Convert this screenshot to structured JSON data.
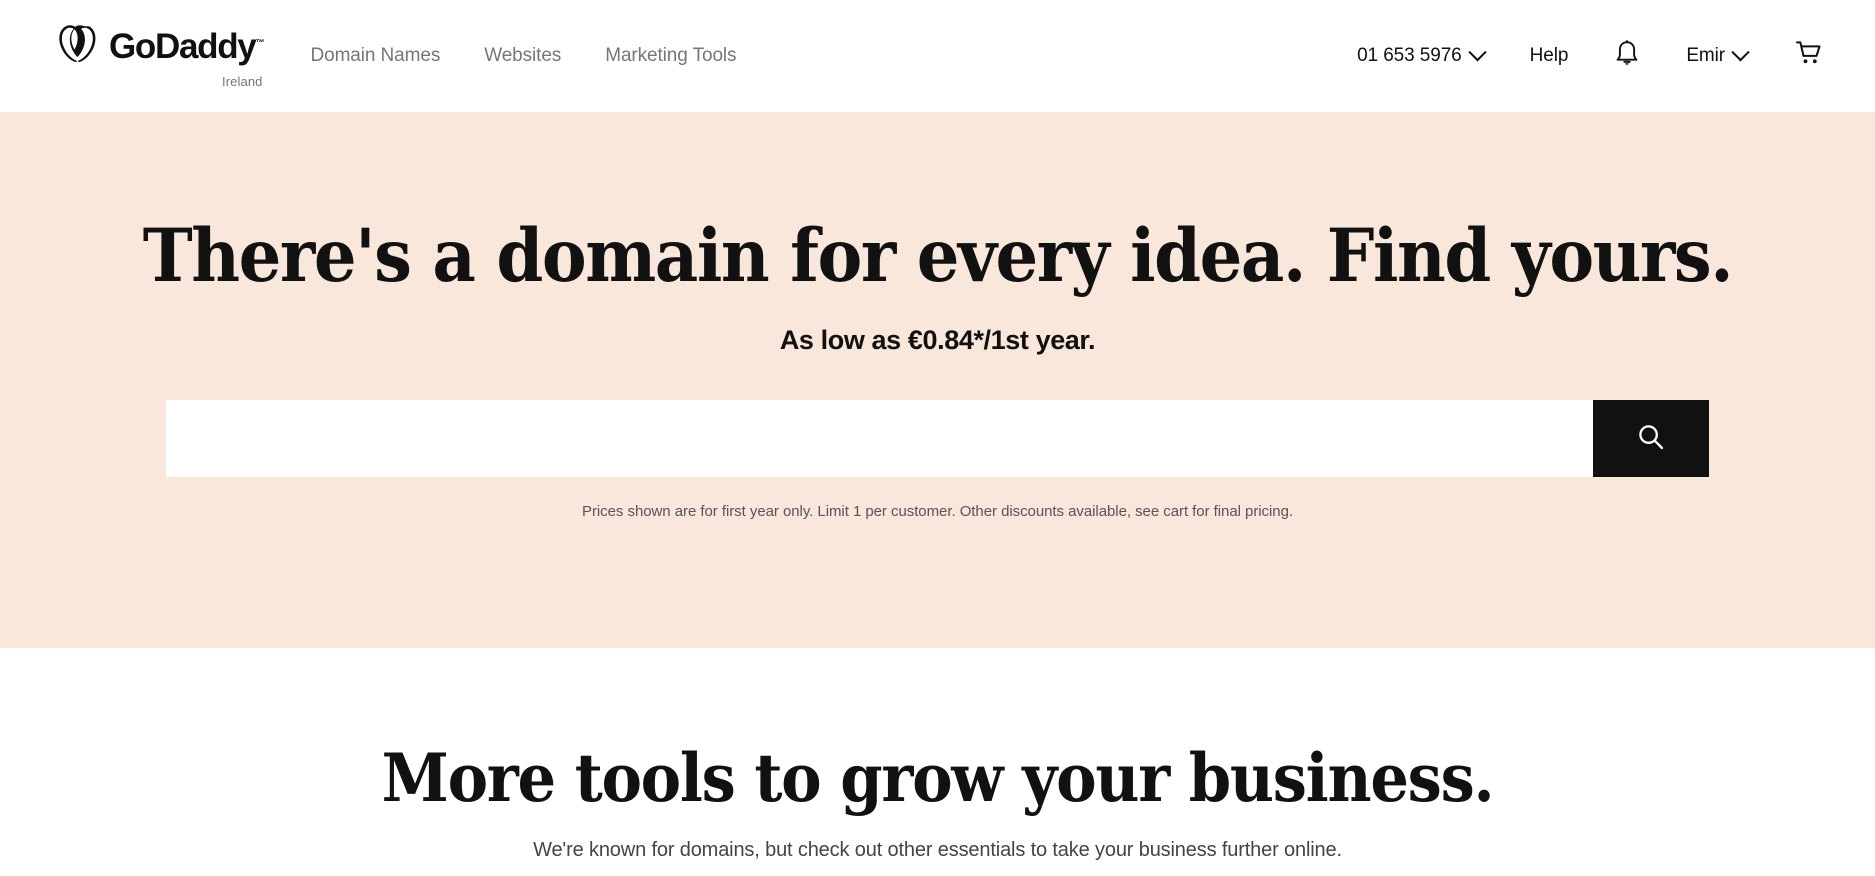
{
  "header": {
    "brand": {
      "name": "GoDaddy",
      "trademark": "™",
      "locale": "Ireland",
      "logo_icon": "godaddy-heart-logo-icon"
    },
    "nav": [
      {
        "label": "Domain Names"
      },
      {
        "label": "Websites"
      },
      {
        "label": "Marketing Tools"
      }
    ],
    "phone": {
      "label": "01 653 5976",
      "chevron_icon": "chevron-down-icon"
    },
    "help_label": "Help",
    "notifications_icon": "bell-icon",
    "account": {
      "label": "Emir",
      "chevron_icon": "chevron-down-icon"
    },
    "cart_icon": "cart-icon"
  },
  "hero": {
    "title": "There's a domain for every idea. Find yours.",
    "subtitle": "As low as €0.84*/1st year.",
    "search": {
      "value": "",
      "placeholder": "",
      "button_icon": "search-icon"
    },
    "fine_print": "Prices shown are for first year only. Limit 1 per customer. Other discounts available, see cart for final pricing.",
    "background_color": "#fae7db"
  },
  "tools": {
    "title": "More tools to grow your business.",
    "subtitle": "We're known for domains, but check out other essentials to take your business further online."
  },
  "colors": {
    "accent_peach": "#fae7db",
    "text_primary": "#111111",
    "text_muted": "#767676",
    "button_black": "#111111"
  }
}
